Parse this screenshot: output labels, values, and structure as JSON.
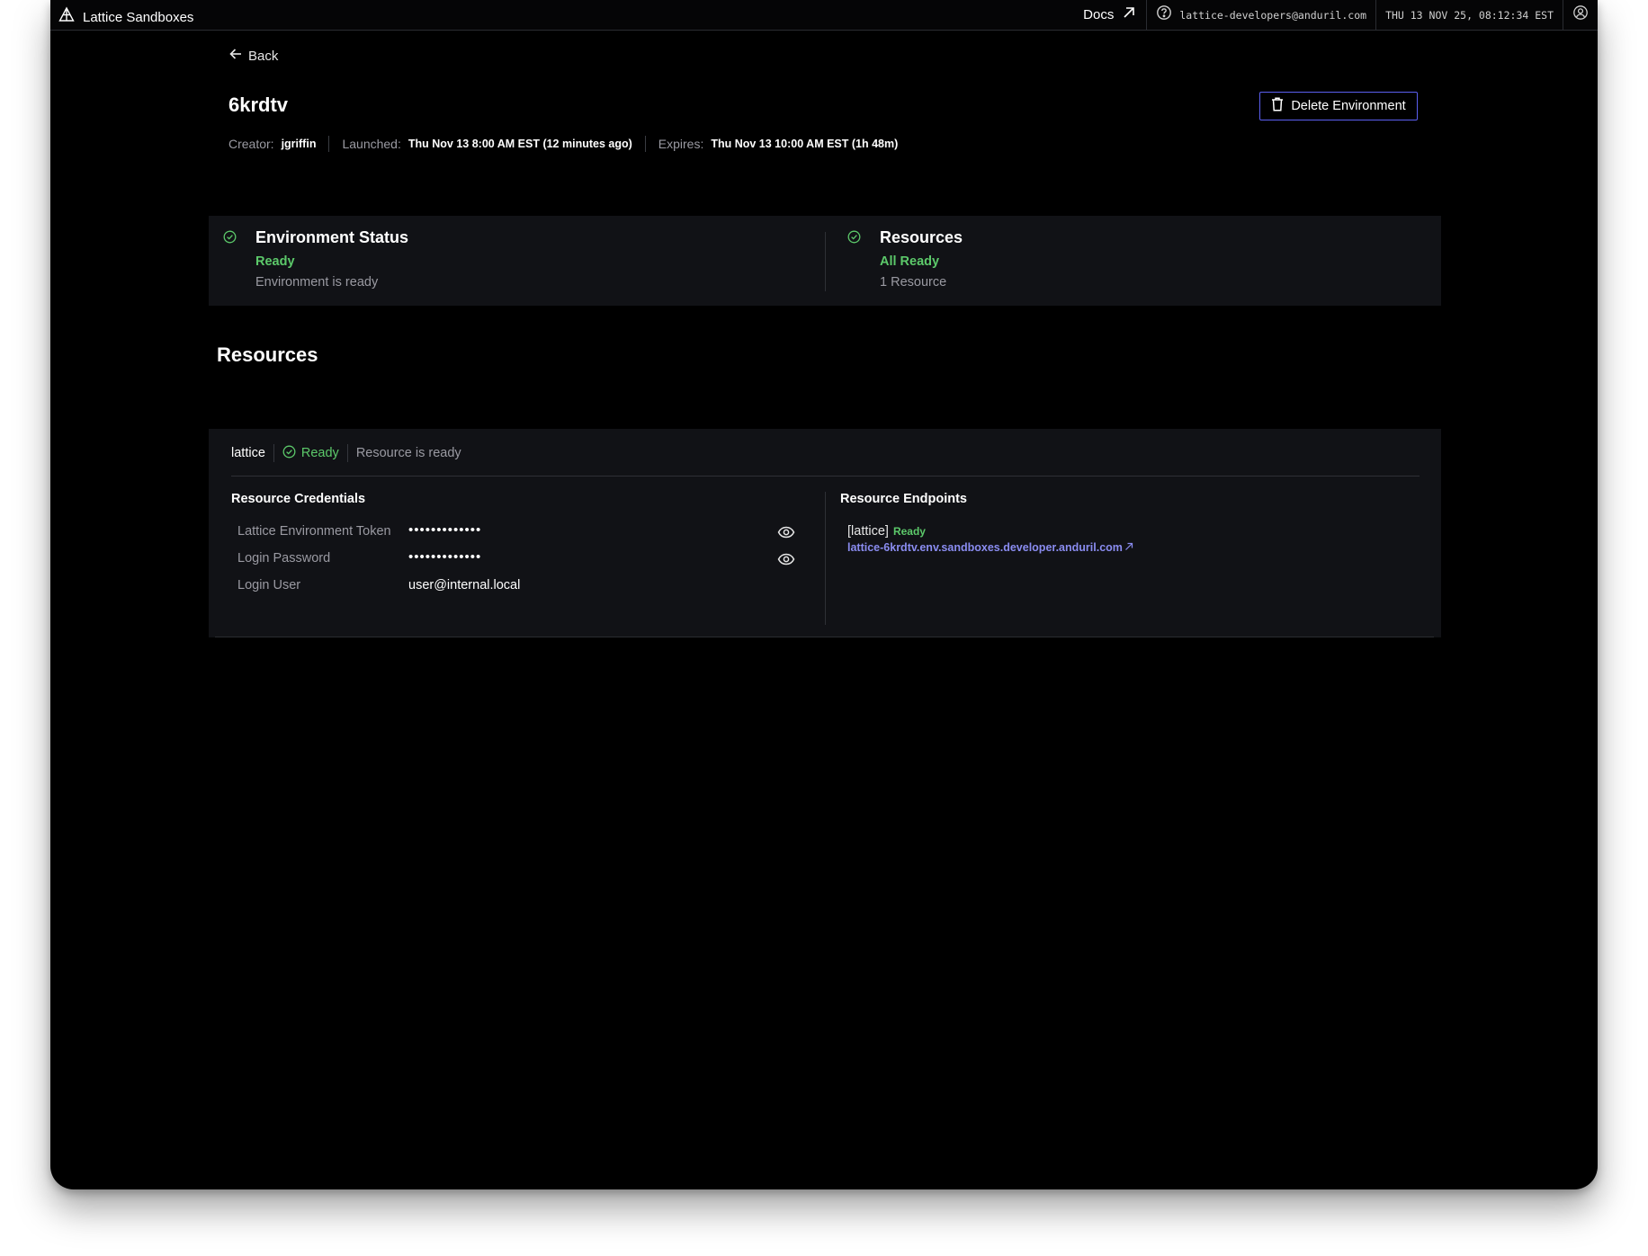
{
  "app": {
    "title": "Lattice Sandboxes",
    "docs_label": "Docs",
    "support_email": "lattice-developers@anduril.com",
    "datetime": "THU 13 NOV 25, 08:12:34 EST"
  },
  "nav": {
    "back_label": "Back"
  },
  "environment": {
    "name": "6krdtv",
    "delete_label": "Delete Environment",
    "creator_label": "Creator:",
    "creator": "jgriffin",
    "launched_label": "Launched:",
    "launched": "Thu Nov 13 8:00 AM EST (12 minutes ago)",
    "expires_label": "Expires:",
    "expires": "Thu Nov 13 10:00 AM EST (1h 48m)"
  },
  "status": {
    "environment": {
      "title": "Environment Status",
      "state": "Ready",
      "description": "Environment is ready"
    },
    "resources": {
      "title": "Resources",
      "state": "All Ready",
      "description": "1 Resource"
    }
  },
  "resources_section": {
    "title": "Resources",
    "resource": {
      "name": "lattice",
      "status": "Ready",
      "message": "Resource is ready",
      "credentials_title": "Resource Credentials",
      "credentials": [
        {
          "label": "Lattice Environment Token",
          "value": "•••••••••••••",
          "masked": true
        },
        {
          "label": "Login Password",
          "value": "•••••••••••••",
          "masked": true
        },
        {
          "label": "Login User",
          "value": "user@internal.local",
          "masked": false
        }
      ],
      "endpoints_title": "Resource Endpoints",
      "endpoint": {
        "name": "[lattice]",
        "status": "Ready",
        "url": "lattice-6krdtv.env.sandboxes.developer.anduril.com"
      }
    }
  },
  "colors": {
    "accent": "#5b5ff0",
    "link": "#8a8cf0",
    "ready_green": "#5cc96a",
    "background": "#000000",
    "panel": "#111216"
  }
}
